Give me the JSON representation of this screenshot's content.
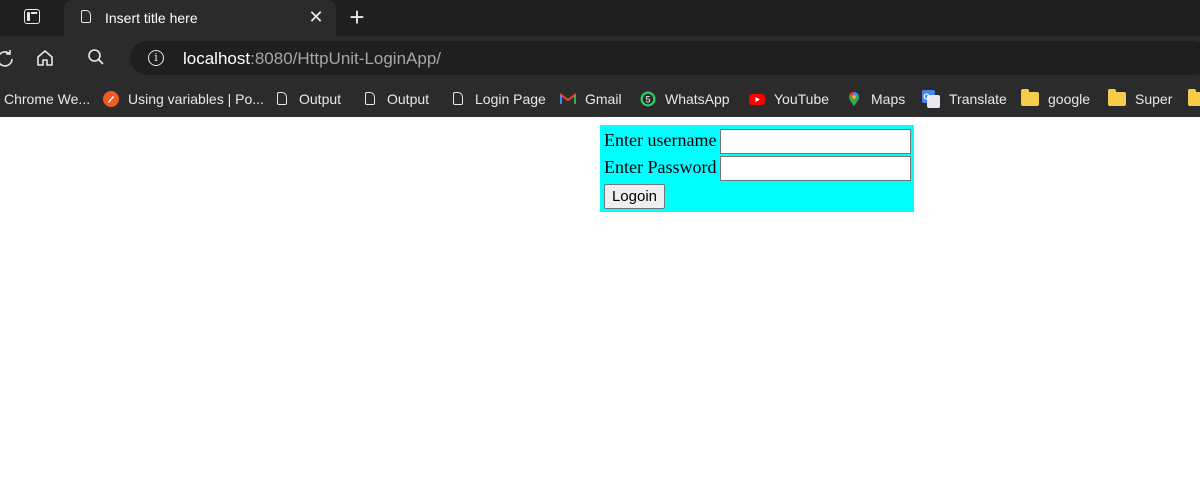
{
  "tab": {
    "title": "Insert title here",
    "close_glyph": "✕",
    "new_tab_glyph": "+"
  },
  "omnibox": {
    "host": "localhost",
    "rest": ":8080/HttpUnit-LoginApp/",
    "info_glyph": "i"
  },
  "bookmarks": [
    {
      "label": "Chrome We...",
      "icon": "none"
    },
    {
      "label": "Using variables | Po...",
      "icon": "postman-icon",
      "color": "#ef5b25"
    },
    {
      "label": "Output",
      "icon": "page-icon"
    },
    {
      "label": "Output",
      "icon": "page-icon"
    },
    {
      "label": "Login Page",
      "icon": "page-icon"
    },
    {
      "label": "Gmail",
      "icon": "gmail-icon"
    },
    {
      "label": "WhatsApp",
      "icon": "whatsapp-icon",
      "color": "#25d366",
      "badge": "5"
    },
    {
      "label": "YouTube",
      "icon": "youtube-icon",
      "color": "#ff0000"
    },
    {
      "label": "Maps",
      "icon": "maps-icon"
    },
    {
      "label": "Translate",
      "icon": "translate-icon",
      "color": "#4285f4"
    },
    {
      "label": "google",
      "icon": "folder-icon"
    },
    {
      "label": "Super",
      "icon": "folder-icon"
    }
  ],
  "form": {
    "username_label": "Enter username",
    "password_label": "Enter Password",
    "username_value": "",
    "password_value": "",
    "submit_label": "Logoin",
    "background": "#00ffff"
  }
}
